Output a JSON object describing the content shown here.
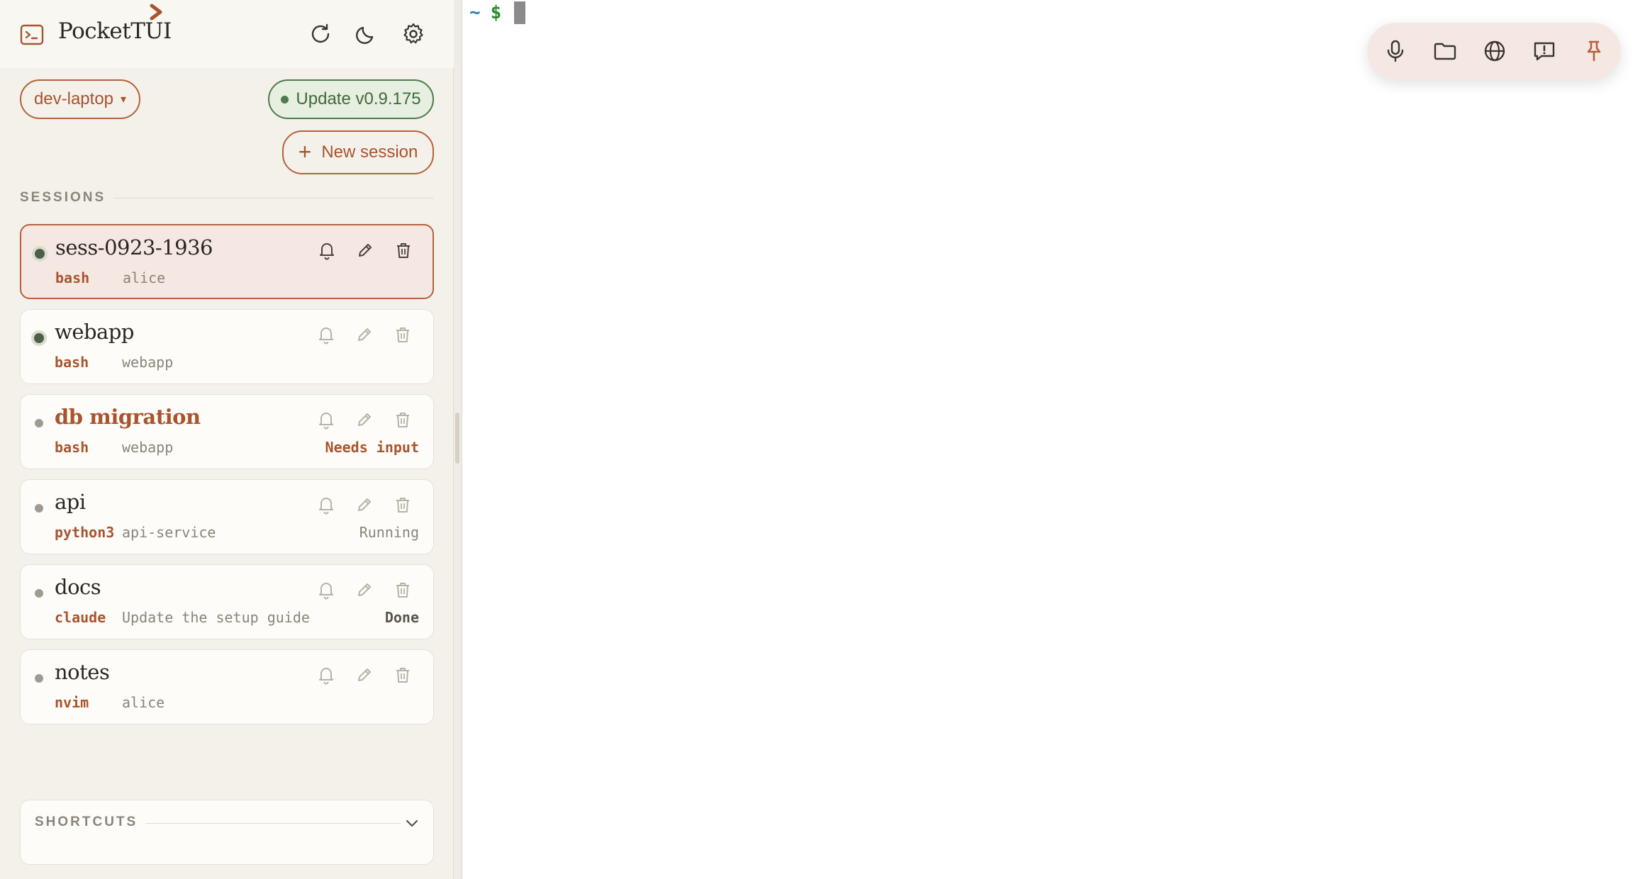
{
  "app": {
    "title": "PocketTUI"
  },
  "header": {
    "icons": [
      "terminal-icon",
      "refresh-icon",
      "moon-icon",
      "gear-icon"
    ]
  },
  "host": {
    "label": "dev-laptop",
    "caret": "▾"
  },
  "update": {
    "label": "Update v0.9.175"
  },
  "new_session": {
    "plus": "+",
    "label": "New session"
  },
  "sessions": {
    "heading": "SESSIONS",
    "items": [
      {
        "name": "sess-0923-1936",
        "command": "bash",
        "directory": "alice",
        "status": ""
      },
      {
        "name": "webapp",
        "command": "bash",
        "directory": "webapp",
        "status": ""
      },
      {
        "name": "db migration",
        "command": "bash",
        "directory": "webapp",
        "status": "Needs input"
      },
      {
        "name": "api",
        "command": "python3",
        "directory": "api-service",
        "status": "Running"
      },
      {
        "name": "docs",
        "command": "claude",
        "directory": "Update the setup guide",
        "status": "Done"
      },
      {
        "name": "notes",
        "command": "nvim",
        "directory": "alice",
        "status": ""
      }
    ]
  },
  "shortcuts": {
    "heading": "SHORTCUTS"
  },
  "terminal": {
    "tilde": "~",
    "prompt": "$"
  },
  "toolbar": {
    "icons": [
      "microphone-icon",
      "folder-icon",
      "globe-icon",
      "feedback-icon",
      "pin-icon"
    ]
  },
  "colors": {
    "accent": "#b5613c",
    "update_green": "#4f7a4a",
    "sidebar_bg": "#f4f1ea",
    "active_card_bg": "#f5e8e3"
  }
}
